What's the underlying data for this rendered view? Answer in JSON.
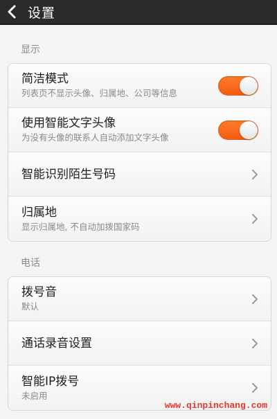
{
  "header": {
    "title": "设置",
    "back_icon": "back-arrow-icon"
  },
  "sections": [
    {
      "label": "显示",
      "rows": [
        {
          "title": "简洁模式",
          "subtitle": "列表页不显示头像、归属地、公司等信息",
          "control": "toggle",
          "on": true
        },
        {
          "title": "使用智能文字头像",
          "subtitle": "为没有头像的联系人自动添加文字头像",
          "control": "toggle",
          "on": true
        },
        {
          "title": "智能识别陌生号码",
          "subtitle": "",
          "control": "chevron"
        },
        {
          "title": "归属地",
          "subtitle": "显示归属地, 不自动加拨国家码",
          "control": "chevron"
        }
      ]
    },
    {
      "label": "电话",
      "rows": [
        {
          "title": "拨号音",
          "subtitle": "默认",
          "control": "chevron"
        },
        {
          "title": "通话录音设置",
          "subtitle": "",
          "control": "chevron"
        },
        {
          "title": "智能IP拨号",
          "subtitle": "未启用",
          "control": "chevron"
        }
      ]
    }
  ],
  "watermark": "www.qinpinchang.com",
  "colors": {
    "accent": "#f2641a",
    "header_bg": "#2b2b2b",
    "watermark": "#e23a2b"
  }
}
